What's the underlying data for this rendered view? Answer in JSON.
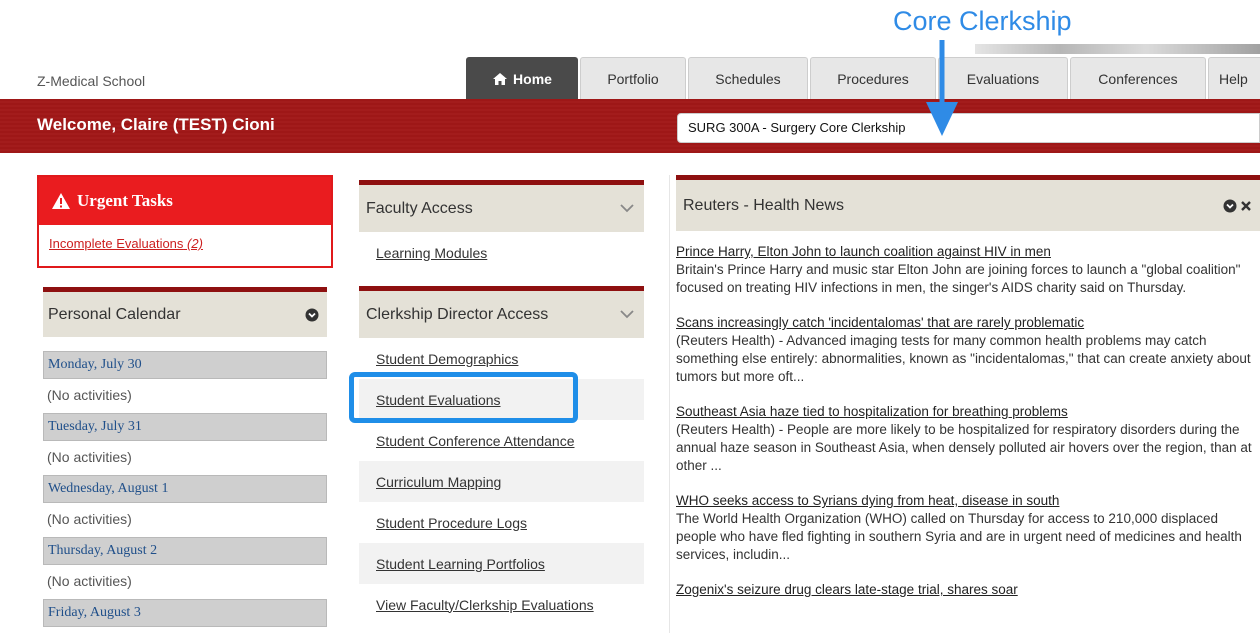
{
  "annotation": {
    "label": "Core Clerkship"
  },
  "header": {
    "school": "Z-Medical School",
    "tabs": [
      "Home",
      "Portfolio",
      "Schedules",
      "Procedures",
      "Evaluations",
      "Conferences",
      "Help"
    ]
  },
  "welcome": {
    "text": "Welcome, Claire (TEST) Cioni",
    "course": "SURG 300A - Surgery Core Clerkship"
  },
  "urgent": {
    "title": "Urgent Tasks",
    "link": "Incomplete Evaluations",
    "count": "(2)"
  },
  "calendar": {
    "title": "Personal Calendar",
    "days": [
      {
        "date": "Monday, July 30",
        "note": "(No activities)"
      },
      {
        "date": "Tuesday, July 31",
        "note": "(No activities)"
      },
      {
        "date": "Wednesday, August 1",
        "note": "(No activities)"
      },
      {
        "date": "Thursday, August 2",
        "note": "(No activities)"
      },
      {
        "date": "Friday, August 3",
        "note": ""
      }
    ]
  },
  "faculty": {
    "title": "Faculty Access",
    "links": [
      "Learning Modules"
    ]
  },
  "director": {
    "title": "Clerkship Director Access",
    "links": [
      "Student Demographics",
      "Student Evaluations",
      "Student Conference Attendance",
      "Curriculum Mapping",
      "Student Procedure Logs",
      "Student Learning Portfolios",
      "View Faculty/Clerkship Evaluations"
    ]
  },
  "news": {
    "title": "Reuters - Health News",
    "items": [
      {
        "title": "Prince Harry, Elton John to launch coalition against HIV in men",
        "body": "Britain's Prince Harry and music star Elton John are joining forces to launch a \"global coalition\" focused on treating HIV infections in men, the singer's AIDS charity said on Thursday."
      },
      {
        "title": "Scans increasingly catch 'incidentalomas' that are rarely problematic",
        "body": "(Reuters Health) - Advanced imaging tests for many common health problems may catch something else entirely: abnormalities, known as \"incidentalomas,\" that can create anxiety about tumors but more oft..."
      },
      {
        "title": "Southeast Asia haze tied to hospitalization for breathing problems",
        "body": "(Reuters Health) - People are more likely to be hospitalized for respiratory disorders during the annual haze season in Southeast Asia, when densely polluted air hovers over the region, than at other ..."
      },
      {
        "title": "WHO seeks access to Syrians dying from heat, disease in south",
        "body": "The World Health Organization (WHO) called on Thursday for access to 210,000 displaced people who have fled fighting in southern Syria and are in urgent need of medicines and health services, includin..."
      },
      {
        "title": "Zogenix's seizure drug clears late-stage trial, shares soar",
        "body": ""
      }
    ]
  },
  "colors": {
    "brand_red": "#9e1717",
    "urgent_red": "#ea1c1f",
    "highlight_blue": "#1f8ee8"
  }
}
